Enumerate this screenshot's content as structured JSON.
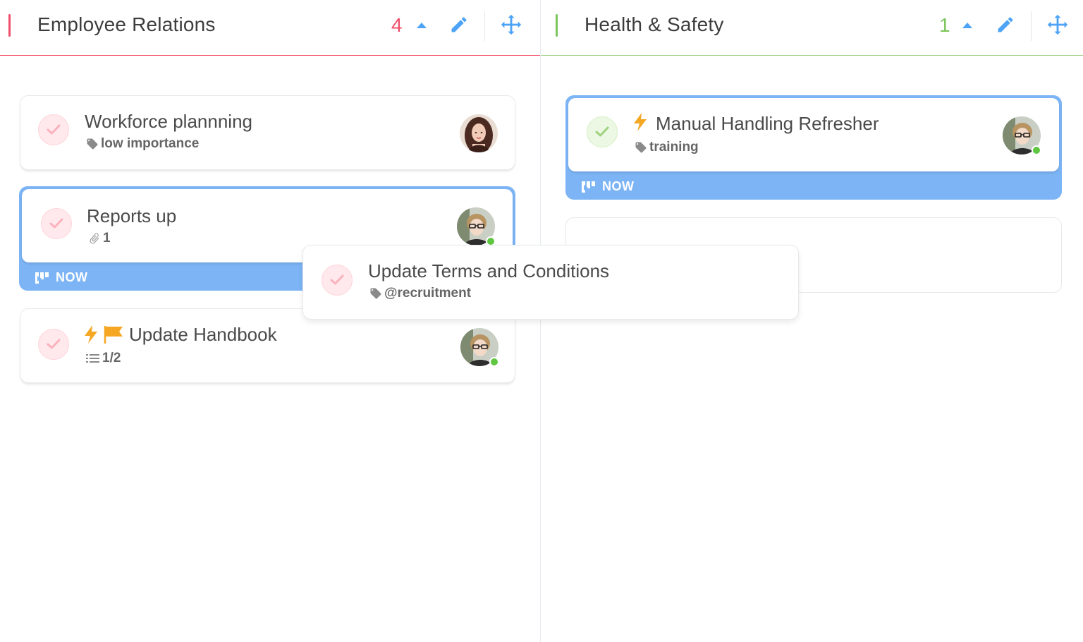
{
  "columns": [
    {
      "title": "Employee Relations",
      "count": "4",
      "accent_color": "#f04e6a",
      "cards": [
        {
          "title": "Workforce plannning",
          "meta": "low importance",
          "meta_icon": "tag-icon",
          "check_color": "red",
          "avatar": "woman-dark-hair"
        },
        {
          "title": "Reports up",
          "meta": "1",
          "meta_icon": "paperclip-icon",
          "check_color": "red",
          "avatar": "woman-glasses",
          "status_label": "NOW"
        },
        {
          "title": "Update Handbook",
          "meta": "1/2",
          "meta_icon": "checklist-icon",
          "check_color": "red",
          "avatar": "woman-glasses",
          "flags": [
            "lightning-icon",
            "flag-icon"
          ]
        }
      ]
    },
    {
      "title": "Health & Safety",
      "count": "1",
      "accent_color": "#7cc55a",
      "cards": [
        {
          "title": "Manual Handling Refresher",
          "meta": "training",
          "meta_icon": "tag-icon",
          "check_color": "green",
          "avatar": "woman-glasses",
          "status_label": "NOW",
          "flags": [
            "lightning-icon"
          ]
        }
      ]
    }
  ],
  "dragging_card": {
    "title": "Update Terms and Conditions",
    "meta": "@recruitment",
    "meta_icon": "tag-icon",
    "check_color": "red"
  },
  "colors": {
    "accent_blue": "#4da3f5",
    "now_bar": "#7cb4f5",
    "lightning": "#f5a623",
    "online": "#5ec641"
  }
}
